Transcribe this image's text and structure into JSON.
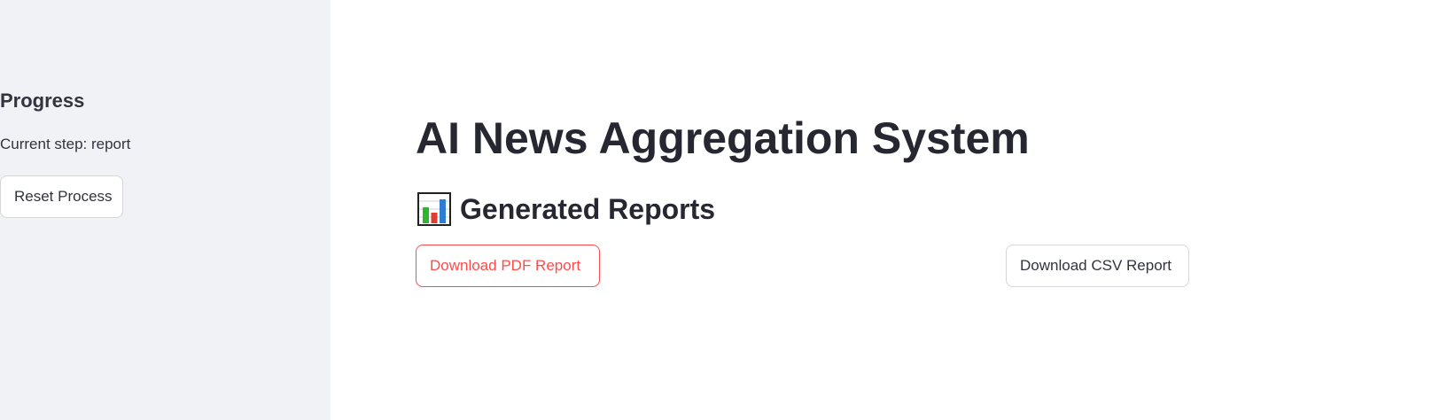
{
  "sidebar": {
    "heading": "Progress",
    "current_step": "Current step: report",
    "reset_label": "Reset Process"
  },
  "main": {
    "title": "AI News Aggregation System",
    "section_icon": "bar-chart-icon",
    "section_heading": "Generated Reports",
    "pdf_button_label": "Download PDF Report",
    "csv_button_label": "Download CSV Report"
  },
  "colors": {
    "sidebar_bg": "#f0f2f6",
    "accent": "#ff4b4b",
    "text": "#31333f"
  }
}
